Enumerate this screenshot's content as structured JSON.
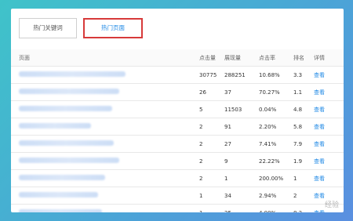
{
  "tabs": [
    {
      "label": "热门关键词",
      "active": false
    },
    {
      "label": "热门页面",
      "active": true
    }
  ],
  "table": {
    "headers": [
      "页面",
      "点击量",
      "展现量",
      "点击率",
      "排名",
      "详情"
    ],
    "rows": [
      {
        "clicks": "30775",
        "impressions": "288251",
        "ctr": "10.68%",
        "rank": "3.3",
        "action": "查看",
        "blur_len": 0.62
      },
      {
        "clicks": "26",
        "impressions": "37",
        "ctr": "70.27%",
        "rank": "1.1",
        "action": "查看",
        "blur_len": 0.58
      },
      {
        "clicks": "5",
        "impressions": "11503",
        "ctr": "0.04%",
        "rank": "4.8",
        "action": "查看",
        "blur_len": 0.54
      },
      {
        "clicks": "2",
        "impressions": "91",
        "ctr": "2.20%",
        "rank": "5.8",
        "action": "查看",
        "blur_len": 0.42
      },
      {
        "clicks": "2",
        "impressions": "27",
        "ctr": "7.41%",
        "rank": "7.9",
        "action": "查看",
        "blur_len": 0.55
      },
      {
        "clicks": "2",
        "impressions": "9",
        "ctr": "22.22%",
        "rank": "1.9",
        "action": "查看",
        "blur_len": 0.58
      },
      {
        "clicks": "2",
        "impressions": "1",
        "ctr": "200.00%",
        "rank": "1",
        "action": "查看",
        "blur_len": 0.5
      },
      {
        "clicks": "1",
        "impressions": "34",
        "ctr": "2.94%",
        "rank": "2",
        "action": "查看",
        "blur_len": 0.46
      },
      {
        "clicks": "1",
        "impressions": "25",
        "ctr": "4.00%",
        "rank": "8.3",
        "action": "查看",
        "blur_len": 0.48
      }
    ]
  },
  "watermark": "经验"
}
